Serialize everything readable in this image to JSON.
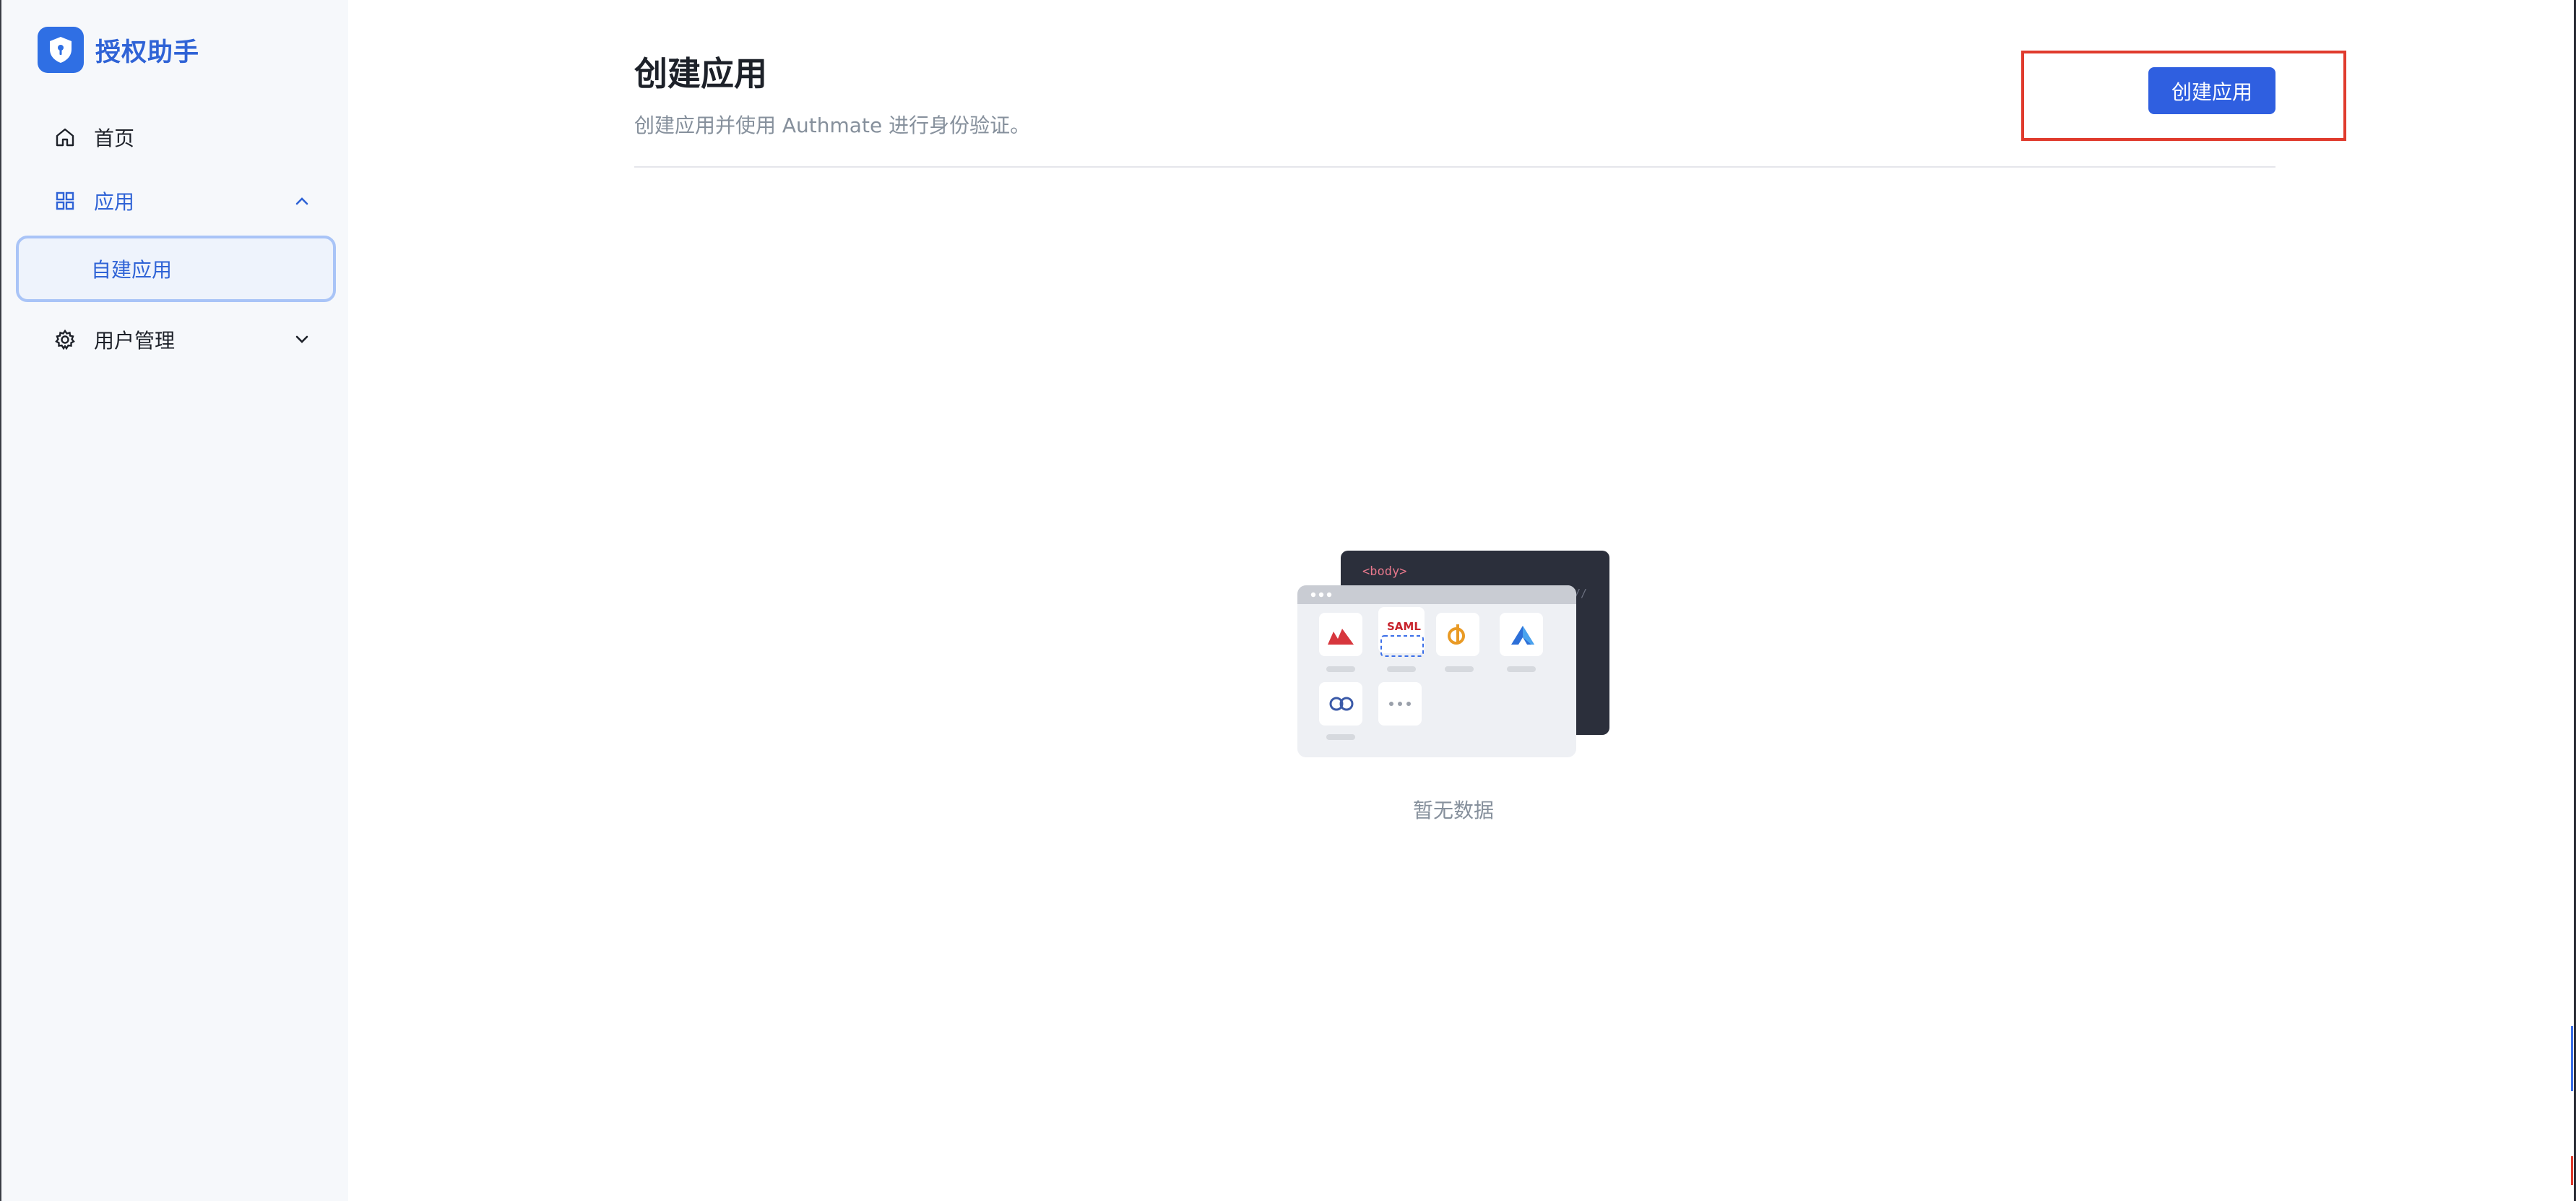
{
  "brand": {
    "name": "授权助手",
    "logo_icon": "shield-lock-icon",
    "color": "#2f6fe4"
  },
  "sidebar": {
    "items": [
      {
        "label": "首页",
        "icon": "home-icon"
      },
      {
        "label": "应用",
        "icon": "grid-icon",
        "expanded": true
      },
      {
        "label": "自建应用",
        "selected": true
      },
      {
        "label": "用户管理",
        "icon": "gear-icon",
        "expanded": false
      }
    ]
  },
  "main": {
    "title": "创建应用",
    "description": "创建应用并使用 Authmate 进行身份验证。",
    "create_button_label": "创建应用",
    "empty_text": "暂无数据",
    "illustration_tag": "<body>",
    "illustration_app_label": "SAML"
  },
  "colors": {
    "accent": "#2f5fe0",
    "highlight": "#e03b2d",
    "muted": "#86909c"
  }
}
